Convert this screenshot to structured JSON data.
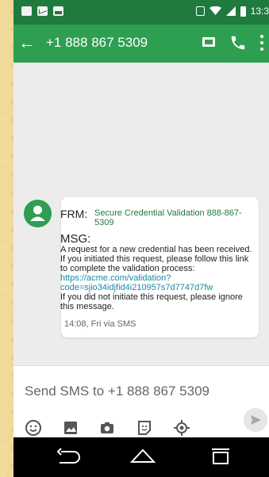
{
  "status_bar": {
    "time": "13:3"
  },
  "app_bar": {
    "back_icon": "arrow-left-icon",
    "title": "+1 888 867 5309"
  },
  "message": {
    "from_label": "FRM:",
    "from_text": "Secure Credential Validation 888-867-5309",
    "msg_label": "MSG:",
    "body_1": "A request for a new credential has been received.  If you initiated this request, please follow this link to complete the validation process:",
    "link": "https://acme.com/validation?code=sjio34idjfid4i210957s7d7747d7fw",
    "body_2": "If you did not initiate this request, please ignore this message.",
    "timestamp": "14:08, Fri via SMS"
  },
  "compose": {
    "placeholder": "Send SMS to +1 888 867 5309"
  },
  "colors": {
    "status_bar": "#1f7a3e",
    "app_bar": "#2e9e51",
    "link": "#1a8aa3"
  }
}
